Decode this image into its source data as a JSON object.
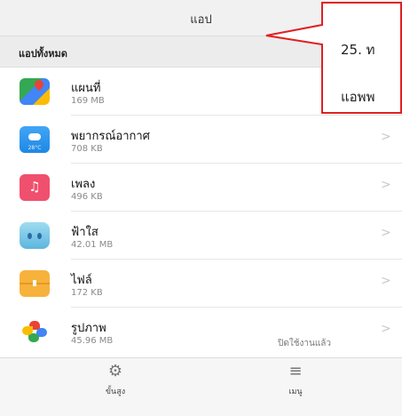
{
  "header": {
    "title": "แอป"
  },
  "section": {
    "label": "แอปทั้งหมด"
  },
  "apps": [
    {
      "icon": "google-maps-icon",
      "name": "แผนที่",
      "size": "169 MB"
    },
    {
      "icon": "weather-icon",
      "name": "พยากรณ์อากาศ",
      "size": "708 KB",
      "icon_text": "28°C"
    },
    {
      "icon": "music-icon",
      "name": "เพลง",
      "size": "496 KB"
    },
    {
      "icon": "anime-avatar-icon",
      "name": "ฟ้าใส",
      "size": "42.01 MB"
    },
    {
      "icon": "files-icon",
      "name": "ไฟล์",
      "size": "172 KB"
    },
    {
      "icon": "google-photos-icon",
      "name": "รูปภาพ",
      "size": "45.96 MB",
      "status": "ปิดใช้งานแล้ว"
    }
  ],
  "chevron": ">",
  "bottom_nav": [
    {
      "icon": "gear-icon",
      "glyph": "⚙",
      "label": "ขั้นสูง"
    },
    {
      "icon": "menu-icon",
      "glyph": "≡",
      "label": "เมนู"
    }
  ],
  "callout": {
    "line1": "25.  ท",
    "line2": "แอพพ"
  },
  "colors": {
    "callout_border": "#e02020",
    "background": "#f4f4f4",
    "list_bg": "#ffffff"
  }
}
